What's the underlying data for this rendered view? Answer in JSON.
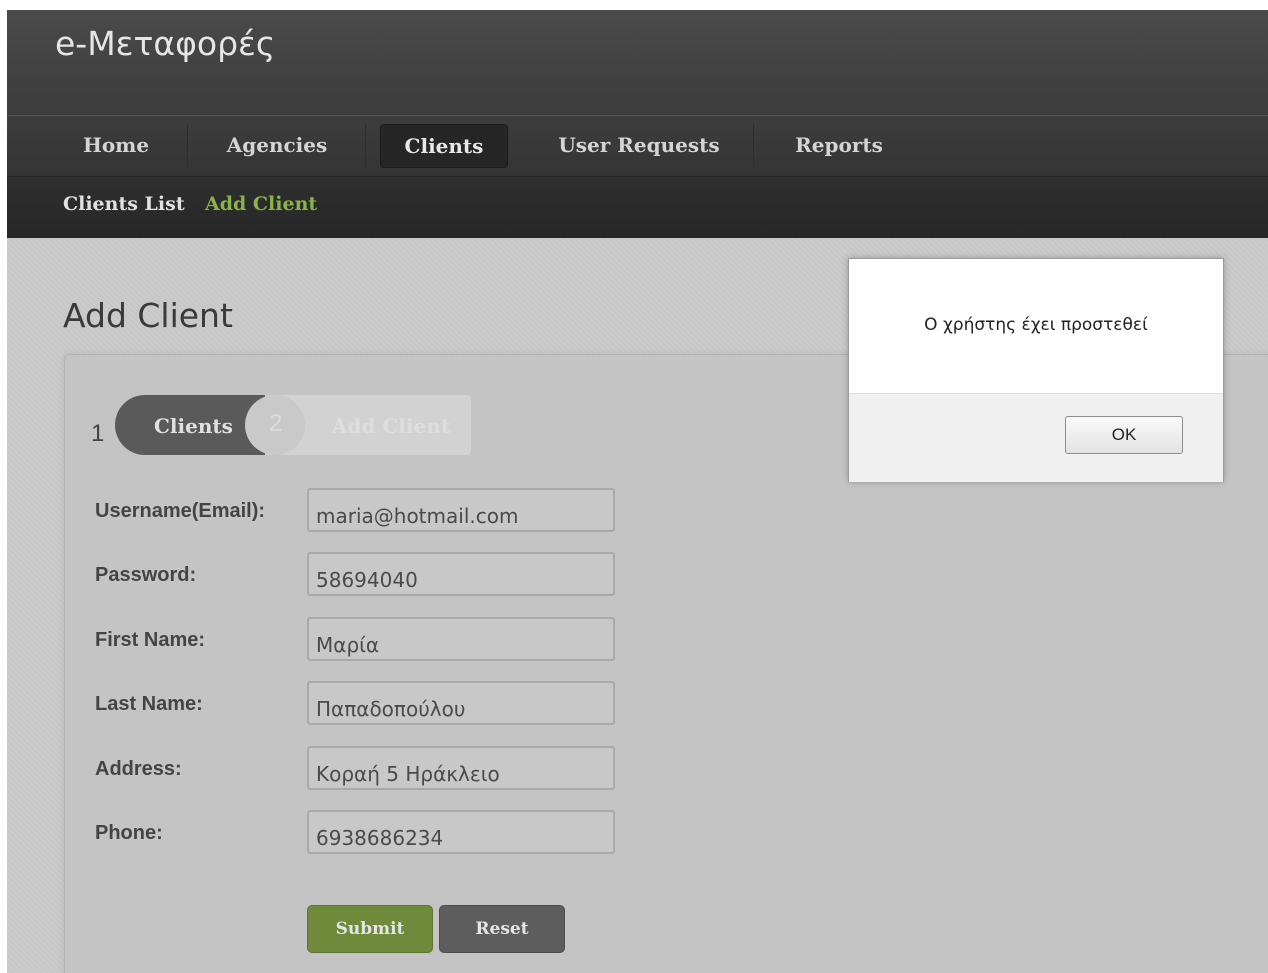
{
  "app": {
    "title": "e-Μεταφορές"
  },
  "nav": {
    "items": [
      {
        "label": "Home"
      },
      {
        "label": "Agencies"
      },
      {
        "label": "Clients"
      },
      {
        "label": "User Requests"
      },
      {
        "label": "Reports"
      }
    ],
    "active": "Clients"
  },
  "subnav": {
    "items": [
      {
        "label": "Clients List",
        "color": "#e2e2e2"
      },
      {
        "label": "Add Client",
        "color": "#8ab34a"
      }
    ]
  },
  "page": {
    "title": "Add Client"
  },
  "wizard": {
    "steps": [
      {
        "number": "1",
        "label": "Clients"
      },
      {
        "number": "2",
        "label": "Add Client"
      }
    ]
  },
  "form": {
    "fields": [
      {
        "label": "Username(Email):",
        "value": "maria@hotmail.com"
      },
      {
        "label": "Password:",
        "value": "58694040"
      },
      {
        "label": "First Name:",
        "value": "Μαρία"
      },
      {
        "label": "Last Name:",
        "value": "Παπαδοπούλου"
      },
      {
        "label": "Address:",
        "value": "Κοραή 5 Ηράκλειο"
      },
      {
        "label": "Phone:",
        "value": "6938686234"
      }
    ],
    "submit_label": "Submit",
    "reset_label": "Reset"
  },
  "dialog": {
    "message": "Ο χρήστης έχει προστεθεί",
    "ok_label": "OK"
  },
  "colors": {
    "accent_green": "#8ab34a",
    "submit_green": "#6f8a3b",
    "header_dark": "#3c3c3c"
  }
}
